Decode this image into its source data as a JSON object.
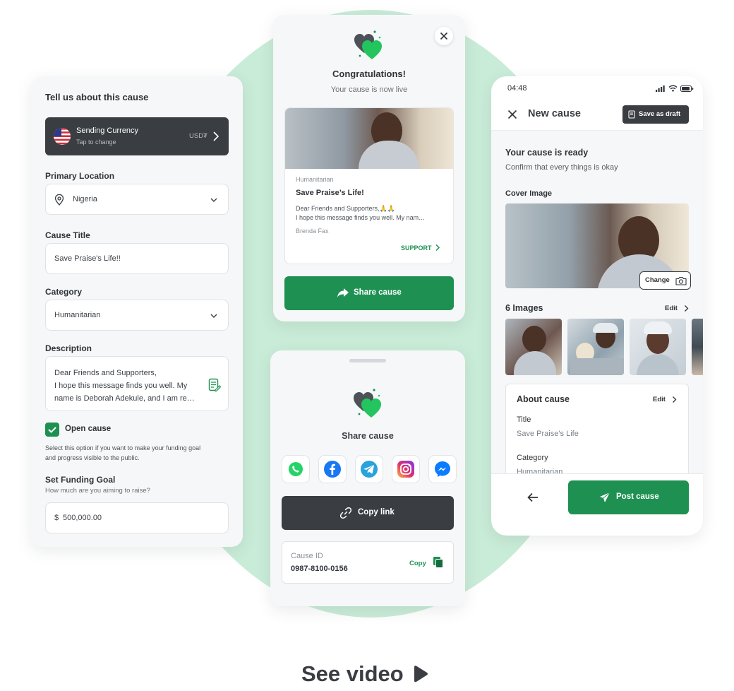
{
  "form": {
    "heading": "Tell us about this cause",
    "currency": {
      "title": "Sending Currency",
      "subtitle": "Tap to change",
      "code": "USD₮"
    },
    "location": {
      "label": "Primary Location",
      "value": "Nigeria"
    },
    "title_field": {
      "label": "Cause Title",
      "value": "Save Praise's Life!!"
    },
    "category": {
      "label": "Category",
      "value": "Humanitarian"
    },
    "description": {
      "label": "Description",
      "line1": "Dear Friends and Supporters,",
      "line2": "I hope this message finds you well. My",
      "line3": "name is Deborah Adekule, and I am re…"
    },
    "open_cause": {
      "label": "Open cause",
      "checked": true,
      "help1": "Select this option if you want to make your funding goal",
      "help2": "and progress visible to the public."
    },
    "goal": {
      "label": "Set Funding Goal",
      "hint": "How much are you aiming to raise?",
      "currency_symbol": "$",
      "value": "500,000.00"
    }
  },
  "congrats": {
    "title": "Congratulations!",
    "subtitle": "Your cause is now live",
    "preview": {
      "category": "Humanitarian",
      "title": "Save Praise’s Life!",
      "excerpt1": "Dear Friends and Supporters,🙏🙏",
      "excerpt2": "I hope this message finds you well. My nam…",
      "author": "Brenda Fax",
      "support_label": "SUPPORT"
    },
    "share_button": "Share cause"
  },
  "share": {
    "title": "Share cause",
    "apps": [
      "whatsapp-icon",
      "facebook-icon",
      "telegram-icon",
      "instagram-icon",
      "messenger-icon"
    ],
    "copy_link": "Copy link",
    "cause_id_label": "Cause ID",
    "cause_id": "0987-8100-0156",
    "copy_label": "Copy"
  },
  "phone": {
    "time": "04:48",
    "header_title": "New cause",
    "save_draft": "Save as draft",
    "ready_title": "Your cause is ready",
    "ready_sub": "Confirm that every things is okay",
    "cover_label": "Cover Image",
    "change_label": "Change",
    "images_label": "6 Images",
    "edit_label": "Edit",
    "about_title": "About cause",
    "about_edit": "Edit",
    "about_fields": [
      {
        "label": "Title",
        "value": "Save Praise’s Life"
      },
      {
        "label": "Category",
        "value": "Humanitarian"
      }
    ],
    "post_button": "Post cause"
  },
  "cta": {
    "label": "See video"
  },
  "colors": {
    "brand_green": "#1e9152",
    "dark": "#3a3d42",
    "mint_bg": "#c9ecd8"
  }
}
